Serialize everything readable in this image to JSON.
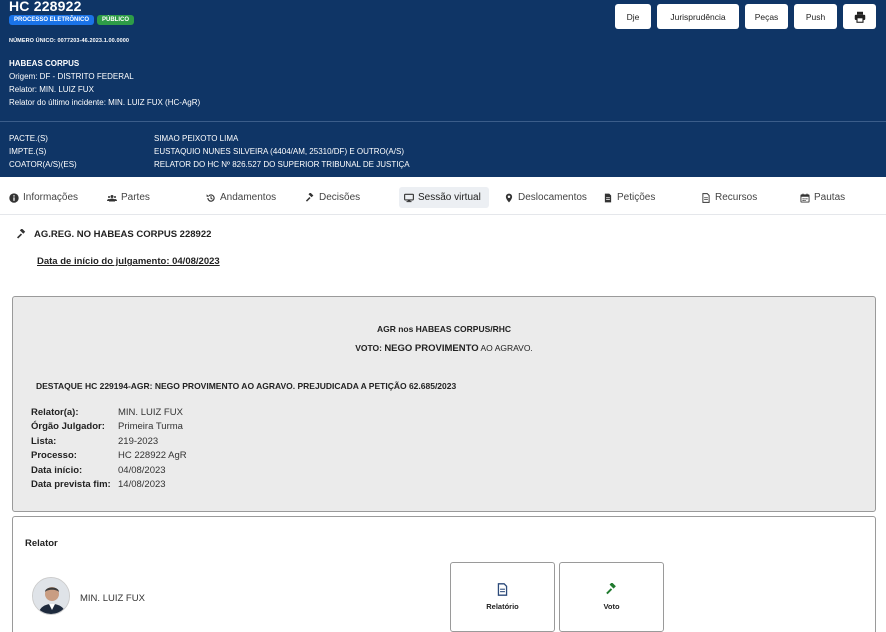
{
  "header": {
    "case_title": "HC 228922",
    "badges": [
      "PROCESSO ELETRÔNICO",
      "PÚBLICO"
    ],
    "numero_unico": "NÚMERO ÚNICO: 0077203-46.2023.1.00.0000",
    "classe": "HABEAS CORPUS",
    "origem": "Origem: DF - DISTRITO FEDERAL",
    "relator": "Relator: MIN. LUIZ FUX",
    "relator_ultimo": "Relator do último incidente: MIN. LUIZ FUX (HC-AgR)",
    "parties": [
      {
        "label": "PACTE.(S)",
        "value": "SIMAO PEIXOTO LIMA"
      },
      {
        "label": "IMPTE.(S)",
        "value": "EUSTAQUIO NUNES SILVEIRA (4404/AM, 25310/DF) E OUTRO(A/S)"
      },
      {
        "label": "COATOR(A/S)(ES)",
        "value": "RELATOR DO HC Nº 826.527 DO SUPERIOR TRIBUNAL DE JUSTIÇA"
      }
    ],
    "buttons": {
      "dje": "Dje",
      "jurisprudencia": "Jurisprudência",
      "pecas": "Peças",
      "push": "Push"
    },
    "print_icon": "print-icon"
  },
  "tabs": [
    {
      "label": "Informações",
      "icon": "info-icon"
    },
    {
      "label": "Partes",
      "icon": "users-icon"
    },
    {
      "label": "Andamentos",
      "icon": "history-icon"
    },
    {
      "label": "Decisões",
      "icon": "gavel-icon"
    },
    {
      "label": "Sessão virtual",
      "icon": "desktop-icon",
      "active": true
    },
    {
      "label": "Deslocamentos",
      "icon": "map-marker-icon"
    },
    {
      "label": "Petições",
      "icon": "file-icon"
    },
    {
      "label": "Recursos",
      "icon": "file-text-icon"
    },
    {
      "label": "Pautas",
      "icon": "calendar-icon"
    }
  ],
  "section": {
    "title": "AG.REG. NO HABEAS CORPUS 228922",
    "judgment_date": "Data de início do julgamento: 04/08/2023"
  },
  "session_card": {
    "title": "AGR nos HABEAS CORPUS/RHC",
    "voto_prefix": "VOTO: ",
    "voto_emphasis": "NEGO PROVIMENTO",
    "voto_suffix": " AO AGRAVO.",
    "destaque": "DESTAQUE HC 229194-AGR: NEGO PROVIMENTO AO AGRAVO. PREJUDICADA A PETIÇÃO 62.685/2023",
    "details": [
      {
        "label": "Relator(a):",
        "value": "MIN. LUIZ FUX"
      },
      {
        "label": "Órgão Julgador:",
        "value": "Primeira Turma"
      },
      {
        "label": "Lista:",
        "value": "219-2023"
      },
      {
        "label": "Processo:",
        "value": "HC 228922 AgR"
      },
      {
        "label": "Data início:",
        "value": "04/08/2023"
      },
      {
        "label": "Data prevista fim:",
        "value": "14/08/2023"
      }
    ]
  },
  "relator_card": {
    "title": "Relator",
    "name": "MIN. LUIZ FUX",
    "actions": {
      "relatorio": "Relatório",
      "voto": "Voto"
    }
  },
  "colors": {
    "header_bg": "#0f3566",
    "badge_blue": "#1a73e8",
    "badge_green": "#2e9c47",
    "card_bg": "#ebebeb",
    "action_green": "#1f7a2e",
    "action_blue": "#2c4a7a"
  }
}
